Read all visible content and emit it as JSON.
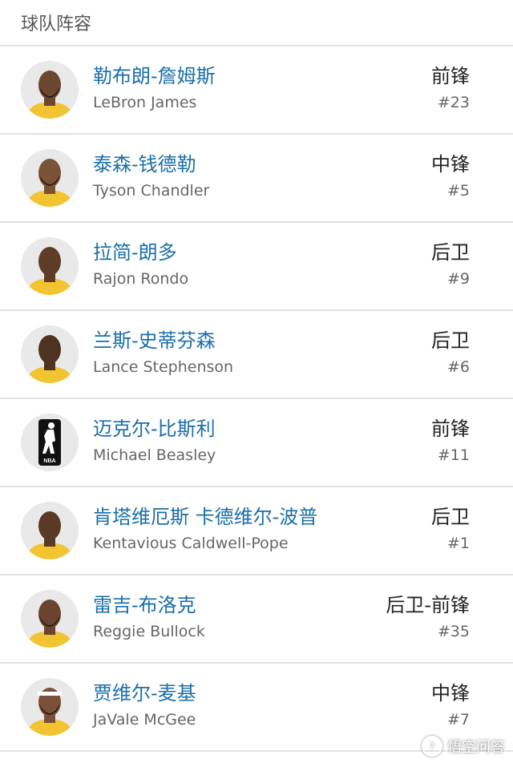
{
  "header": {
    "title": "球队阵容"
  },
  "players": [
    {
      "cn": "勒布朗-詹姆斯",
      "en": "LeBron James",
      "position": "前锋",
      "number": "#23",
      "skin": "#6b4630",
      "beard": true,
      "headband": false,
      "logo": false
    },
    {
      "cn": "泰森-钱德勒",
      "en": "Tyson Chandler",
      "position": "中锋",
      "number": "#5",
      "skin": "#7a5238",
      "beard": true,
      "headband": false,
      "logo": false
    },
    {
      "cn": "拉简-朗多",
      "en": "Rajon Rondo",
      "position": "后卫",
      "number": "#9",
      "skin": "#5e3d28",
      "beard": false,
      "headband": false,
      "logo": false
    },
    {
      "cn": "兰斯-史蒂芬森",
      "en": "Lance Stephenson",
      "position": "后卫",
      "number": "#6",
      "skin": "#4e3222",
      "beard": false,
      "headband": false,
      "logo": false
    },
    {
      "cn": "迈克尔-比斯利",
      "en": "Michael Beasley",
      "position": "前锋",
      "number": "#11",
      "skin": "",
      "beard": false,
      "headband": false,
      "logo": true
    },
    {
      "cn": "肯塔维厄斯 卡德维尔-波普",
      "en": "Kentavious Caldwell-Pope",
      "position": "后卫",
      "number": "#1",
      "skin": "#5a3a26",
      "beard": false,
      "headband": false,
      "logo": false
    },
    {
      "cn": "雷吉-布洛克",
      "en": "Reggie Bullock",
      "position": "后卫-前锋",
      "number": "#35",
      "skin": "#6a4430",
      "beard": true,
      "headband": false,
      "logo": false
    },
    {
      "cn": "贾维尔-麦基",
      "en": "JaVale McGee",
      "position": "中锋",
      "number": "#7",
      "skin": "#7a5038",
      "beard": true,
      "headband": true,
      "logo": false
    }
  ],
  "watermark": {
    "text": "悟空问答"
  },
  "colors": {
    "jersey": "#f2c431",
    "name_link": "#1b6fa8",
    "divider": "#e2e2e2"
  }
}
